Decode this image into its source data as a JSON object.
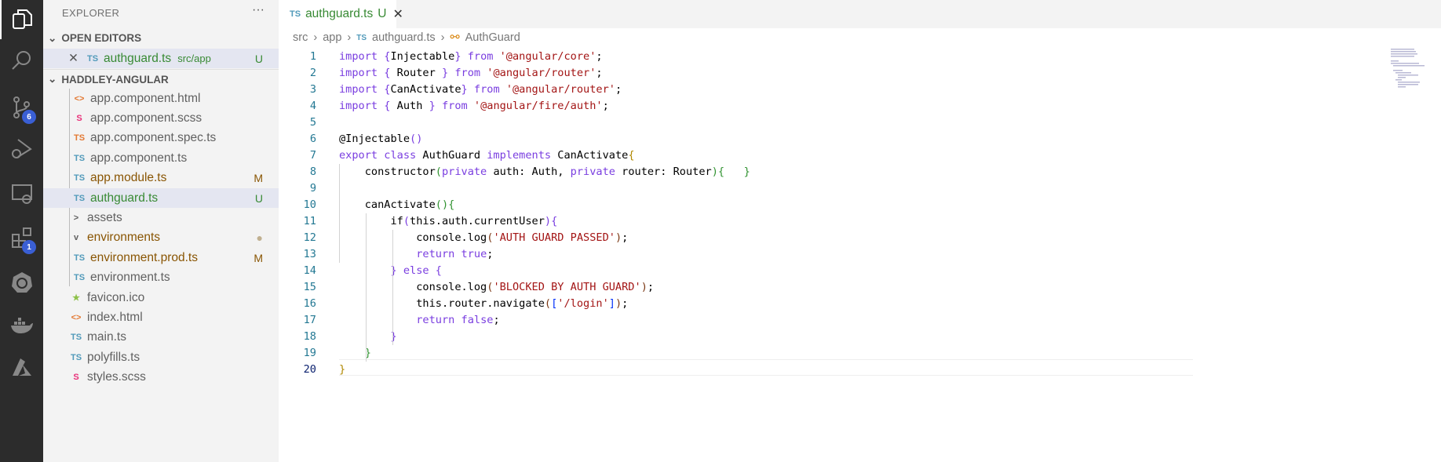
{
  "activity": {
    "scm_badge": "6",
    "ext_badge": "1"
  },
  "sidebar": {
    "title": "EXPLORER",
    "more": "···",
    "open_editors": {
      "label": "OPEN EDITORS",
      "items": [
        {
          "icon": "TS",
          "name": "authguard.ts",
          "path": "src/app",
          "status": "U"
        }
      ]
    },
    "project": {
      "label": "HADDLEY-ANGULAR",
      "items": [
        {
          "icon": "<>",
          "name": "app.component.html",
          "color": "#616161",
          "iconColor": "#e37933",
          "status": "",
          "indent": 1
        },
        {
          "icon": "S",
          "name": "app.component.scss",
          "color": "#616161",
          "iconColor": "#e9317a",
          "status": "",
          "indent": 1
        },
        {
          "icon": "TS",
          "name": "app.component.spec.ts",
          "color": "#616161",
          "iconColor": "#e37933",
          "status": "",
          "indent": 1
        },
        {
          "icon": "TS",
          "name": "app.component.ts",
          "color": "#616161",
          "iconColor": "#519aba",
          "status": "",
          "indent": 1
        },
        {
          "icon": "TS",
          "name": "app.module.ts",
          "color": "#895503",
          "iconColor": "#519aba",
          "status": "M",
          "indent": 1
        },
        {
          "icon": "TS",
          "name": "authguard.ts",
          "color": "#388a34",
          "iconColor": "#519aba",
          "status": "U",
          "indent": 1,
          "selected": true
        },
        {
          "icon": ">",
          "name": "assets",
          "color": "#616161",
          "iconColor": "#616161",
          "status": "",
          "indent": 0
        },
        {
          "icon": "v",
          "name": "environments",
          "color": "#895503",
          "iconColor": "#616161",
          "status": "●",
          "indent": 0
        },
        {
          "icon": "TS",
          "name": "environment.prod.ts",
          "color": "#895503",
          "iconColor": "#519aba",
          "status": "M",
          "indent": 1
        },
        {
          "icon": "TS",
          "name": "environment.ts",
          "color": "#616161",
          "iconColor": "#519aba",
          "status": "",
          "indent": 1
        },
        {
          "icon": "★",
          "name": "favicon.ico",
          "color": "#616161",
          "iconColor": "#8dc149",
          "status": "",
          "indent": 0
        },
        {
          "icon": "<>",
          "name": "index.html",
          "color": "#616161",
          "iconColor": "#e37933",
          "status": "",
          "indent": 0
        },
        {
          "icon": "TS",
          "name": "main.ts",
          "color": "#616161",
          "iconColor": "#519aba",
          "status": "",
          "indent": 0
        },
        {
          "icon": "TS",
          "name": "polyfills.ts",
          "color": "#616161",
          "iconColor": "#519aba",
          "status": "",
          "indent": 0
        },
        {
          "icon": "S",
          "name": "styles.scss",
          "color": "#616161",
          "iconColor": "#e9317a",
          "status": "",
          "indent": 0
        }
      ]
    }
  },
  "tab": {
    "icon": "TS",
    "name": "authguard.ts",
    "status": "U"
  },
  "breadcrumb": [
    "src",
    "app",
    "authguard.ts",
    "AuthGuard"
  ],
  "code": [
    [
      [
        "import ",
        "kw"
      ],
      [
        "{",
        "bp"
      ],
      [
        "Injectable",
        ""
      ],
      [
        "}",
        "bp"
      ],
      [
        " from ",
        "kw"
      ],
      [
        "'@angular/core'",
        "st"
      ],
      [
        ";",
        ""
      ]
    ],
    [
      [
        "import ",
        "kw"
      ],
      [
        "{",
        "bp"
      ],
      [
        " Router ",
        ""
      ],
      [
        "}",
        "bp"
      ],
      [
        " from ",
        "kw"
      ],
      [
        "'@angular/router'",
        "st"
      ],
      [
        ";",
        ""
      ]
    ],
    [
      [
        "import ",
        "kw"
      ],
      [
        "{",
        "bp"
      ],
      [
        "CanActivate",
        ""
      ],
      [
        "}",
        "bp"
      ],
      [
        " from ",
        "kw"
      ],
      [
        "'@angular/router'",
        "st"
      ],
      [
        ";",
        ""
      ]
    ],
    [
      [
        "import ",
        "kw"
      ],
      [
        "{",
        "bp"
      ],
      [
        " Auth ",
        ""
      ],
      [
        "}",
        "bp"
      ],
      [
        " from ",
        "kw"
      ],
      [
        "'@angular/fire/auth'",
        "st"
      ],
      [
        ";",
        ""
      ]
    ],
    [],
    [
      [
        "@Injectable",
        ""
      ],
      [
        "()",
        "bp"
      ]
    ],
    [
      [
        "export ",
        "kw"
      ],
      [
        "class ",
        "kw"
      ],
      [
        "AuthGuard ",
        ""
      ],
      [
        "implements ",
        "kw"
      ],
      [
        "CanActivate",
        ""
      ],
      [
        "{",
        "bg"
      ]
    ],
    [
      [
        "    constructor",
        ""
      ],
      [
        "(",
        "b2"
      ],
      [
        "private ",
        "kw"
      ],
      [
        "auth: Auth, ",
        ""
      ],
      [
        "private ",
        "kw"
      ],
      [
        "router: Router",
        ""
      ],
      [
        ")",
        "b2"
      ],
      [
        "{",
        "b2"
      ],
      [
        "   ",
        ""
      ],
      [
        "}",
        "b2"
      ]
    ],
    [],
    [
      [
        "    canActivate",
        ""
      ],
      [
        "()",
        "b2"
      ],
      [
        "{",
        "b2"
      ]
    ],
    [
      [
        "        if",
        ""
      ],
      [
        "(",
        "bp"
      ],
      [
        "this",
        ""
      ],
      [
        ".auth.currentUser",
        ""
      ],
      [
        ")",
        "bp"
      ],
      [
        "{",
        "bp"
      ]
    ],
    [
      [
        "            console.log",
        ""
      ],
      [
        "(",
        "b3"
      ],
      [
        "'AUTH GUARD PASSED'",
        "st"
      ],
      [
        ")",
        "b3"
      ],
      [
        ";",
        ""
      ]
    ],
    [
      [
        "            ",
        ""
      ],
      [
        "return ",
        "kw"
      ],
      [
        "true",
        "kw"
      ],
      [
        ";",
        ""
      ]
    ],
    [
      [
        "        ",
        ""
      ],
      [
        "}",
        "bp"
      ],
      [
        " else ",
        "kw"
      ],
      [
        "{",
        "bp"
      ]
    ],
    [
      [
        "            console.log",
        ""
      ],
      [
        "(",
        "b3"
      ],
      [
        "'BLOCKED BY AUTH GUARD'",
        "st"
      ],
      [
        ")",
        "b3"
      ],
      [
        ";",
        ""
      ]
    ],
    [
      [
        "            this.router.navigate",
        ""
      ],
      [
        "(",
        "b3"
      ],
      [
        "[",
        "b1"
      ],
      [
        "'/login'",
        "st"
      ],
      [
        "]",
        "b1"
      ],
      [
        ")",
        "b3"
      ],
      [
        ";",
        ""
      ]
    ],
    [
      [
        "            ",
        ""
      ],
      [
        "return ",
        "kw"
      ],
      [
        "false",
        "kw"
      ],
      [
        ";",
        ""
      ]
    ],
    [
      [
        "        ",
        ""
      ],
      [
        "}",
        "bp"
      ]
    ],
    [
      [
        "    ",
        ""
      ],
      [
        "}",
        "b2"
      ]
    ],
    [
      [
        "}",
        "bg"
      ]
    ]
  ]
}
